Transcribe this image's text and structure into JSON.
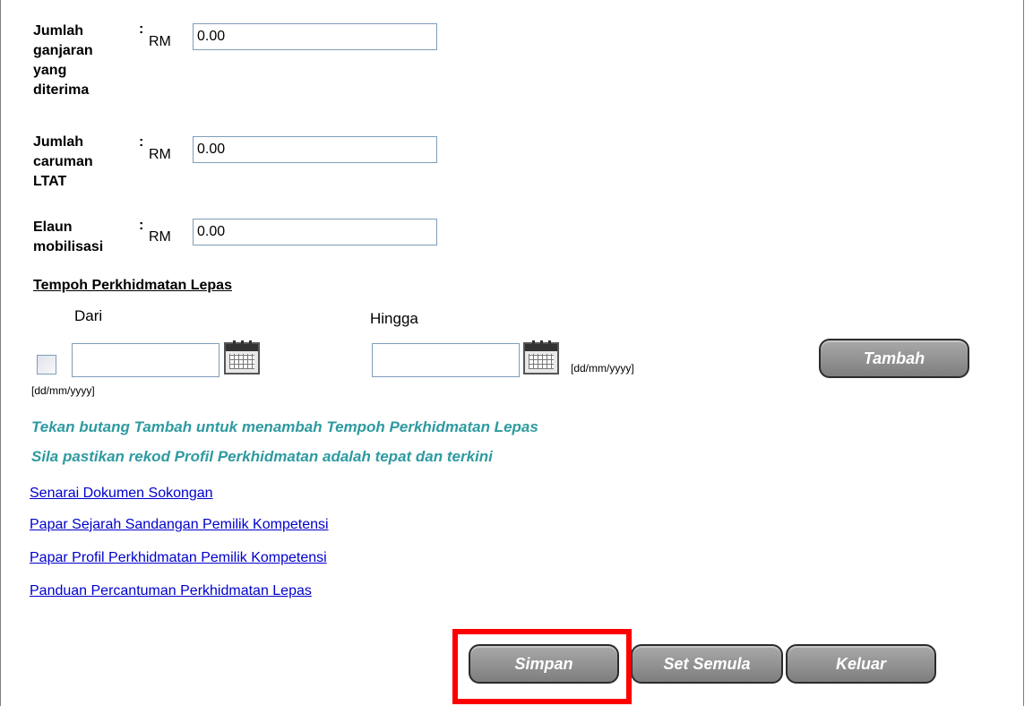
{
  "fields": [
    {
      "label": "Jumlah ganjaran yang diterima",
      "currency": "RM",
      "value": "0.00"
    },
    {
      "label": "Jumlah caruman LTAT",
      "currency": "RM",
      "value": "0.00"
    },
    {
      "label": "Elaun mobilisasi",
      "currency": "RM",
      "value": "0.00"
    }
  ],
  "colon": ":",
  "service_period": {
    "title": "Tempoh Perkhidmatan Lepas",
    "from_label": "Dari",
    "to_label": "Hingga",
    "from_value": "",
    "to_value": "",
    "date_format_hint": "[dd/mm/yyyy]",
    "add_button": "Tambah"
  },
  "messages": [
    "Tekan butang Tambah untuk menambah Tempoh Perkhidmatan Lepas",
    "Sila pastikan rekod Profil Perkhidmatan adalah tepat dan terkini"
  ],
  "links": [
    "Senarai Dokumen Sokongan",
    "Papar Sejarah Sandangan Pemilik Kompetensi",
    "Papar Profil Perkhidmatan Pemilik Kompetensi",
    "Panduan Percantuman Perkhidmatan Lepas"
  ],
  "actions": {
    "save": "Simpan",
    "reset": "Set Semula",
    "exit": "Keluar"
  },
  "colors": {
    "info_text": "#2e9aa1",
    "link": "#0000cc",
    "highlight": "#ff0000",
    "button_bg": "#8f8f8f"
  }
}
